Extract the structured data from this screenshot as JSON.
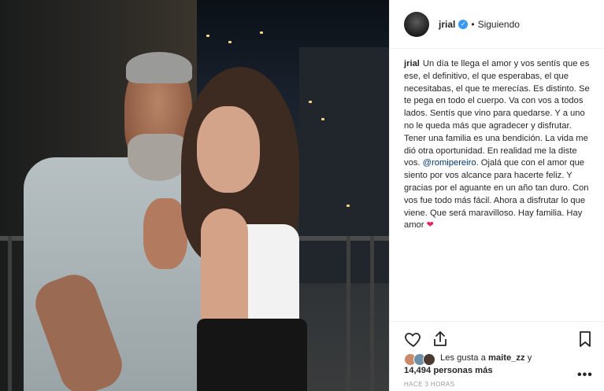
{
  "post": {
    "username": "jrial",
    "follow_status": "Siguiendo",
    "caption_author": "jrial",
    "caption_part1": "Un día te llega el amor y vos sentís que es ese, el definitivo, el que esperabas, el que necesitabas, el que te merecías. Es distinto. Se te pega en todo el cuerpo. Va con vos a todos lados. Sentís que vino para quedarse. Y a uno no le queda más que agradecer y disfrutar. Tener una familia es una bendición. La vida me dió otra oportunidad. En realidad me la diste vos. ",
    "caption_mention": "@romipereiro",
    "caption_part2": ". Ojalá que con el amor que siento por vos alcance para hacerte feliz. Y gracias por el aguante en un año tan duro. Con vos fue todo más fácil. Ahora a disfrutar lo que viene. Que será maravilloso. Hay familia. Hay amor ",
    "caption_heart": "❤",
    "likes_prefix": "Les gusta a ",
    "likes_user": "maite_zz",
    "likes_and": " y",
    "likes_count": "14,494 personas más",
    "more_label": "•••",
    "timestamp": "HACE 3 HORAS"
  },
  "icons": {
    "verified": "verified-badge-icon",
    "like": "heart-outline-icon",
    "share": "share-upload-icon",
    "save": "bookmark-icon"
  },
  "colors": {
    "verified_blue": "#3897f0",
    "mention_blue": "#003569",
    "heart_red": "#e0245e",
    "divider": "#efefef",
    "muted": "#999999"
  }
}
